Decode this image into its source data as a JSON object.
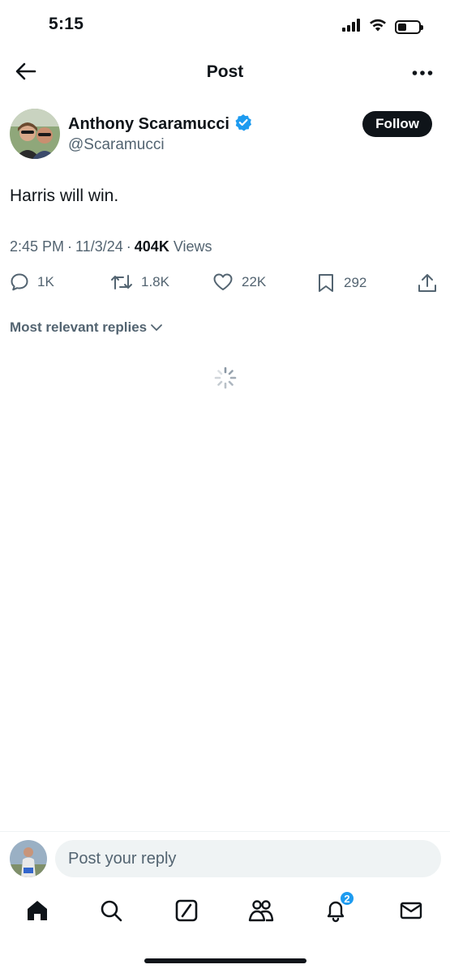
{
  "status_bar": {
    "time": "5:15",
    "icons": [
      "cellular-signal-icon",
      "wifi-icon",
      "battery-icon"
    ],
    "battery_level_percent": 40
  },
  "header": {
    "title": "Post",
    "back_icon": "arrow-left-icon",
    "more_icon": "more-horizontal-icon"
  },
  "author": {
    "name": "Anthony Scaramucci",
    "handle": "@Scaramucci",
    "verified": true,
    "follow_label": "Follow"
  },
  "post": {
    "text": "Harris will win.",
    "time": "2:45 PM",
    "date": "11/3/24",
    "views_count": "404K",
    "views_label": "Views",
    "separator": "·"
  },
  "actions": {
    "replies": "1K",
    "reposts": "1.8K",
    "likes": "22K",
    "bookmarks": "292"
  },
  "replies_sort": {
    "label": "Most relevant replies"
  },
  "reply_bar": {
    "placeholder": "Post your reply"
  },
  "tab_bar": {
    "tabs": [
      "home",
      "search",
      "grok",
      "communities",
      "notifications",
      "messages"
    ],
    "notifications_badge": "2"
  },
  "colors": {
    "text_primary": "#0f1419",
    "text_secondary": "#536471",
    "accent": "#1d9bf0",
    "reply_input_bg": "#eff3f4"
  }
}
